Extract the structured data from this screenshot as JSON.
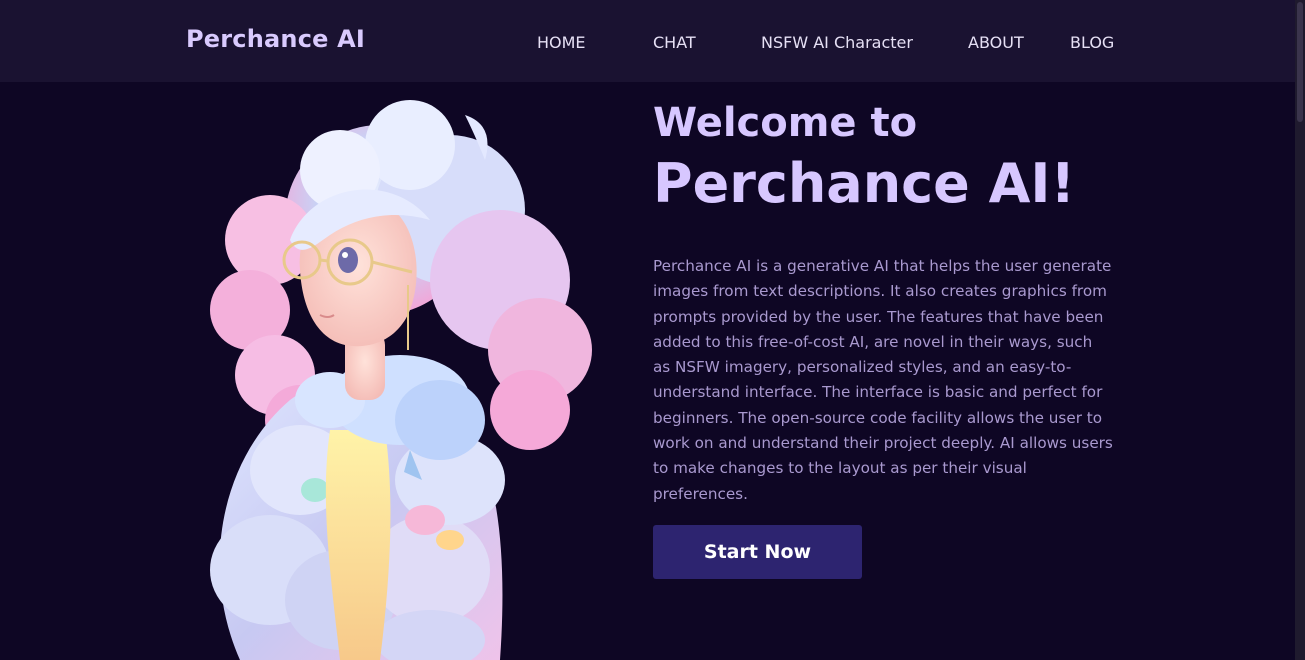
{
  "header": {
    "logo": "Perchance AI",
    "nav": [
      {
        "label": "HOME"
      },
      {
        "label": "CHAT"
      },
      {
        "label": "NSFW AI Character"
      },
      {
        "label": "ABOUT"
      },
      {
        "label": "BLOG"
      }
    ]
  },
  "hero": {
    "title_line1": "Welcome to",
    "title_line2": "Perchance AI!",
    "description": "Perchance AI is a generative AI that helps the user generate images from text descriptions. It also creates graphics from prompts provided by the user. The features that have been added to this free-of-cost AI, are novel in their ways, such as NSFW imagery, personalized styles, and an easy-to-understand interface. The interface is basic and perfect for beginners. The open-source code facility allows the user to work on and understand their project deeply. AI allows users to make changes to the layout as per their visual preferences.",
    "cta_label": "Start Now",
    "image_alt": "3D anime girl with curly pastel hair, glasses and puffy jacket"
  },
  "colors": {
    "background": "#0e0624",
    "header_background": "#1a1231",
    "accent_text": "#d7c7ff",
    "body_text": "#a999cf",
    "button": "#2d2470"
  }
}
